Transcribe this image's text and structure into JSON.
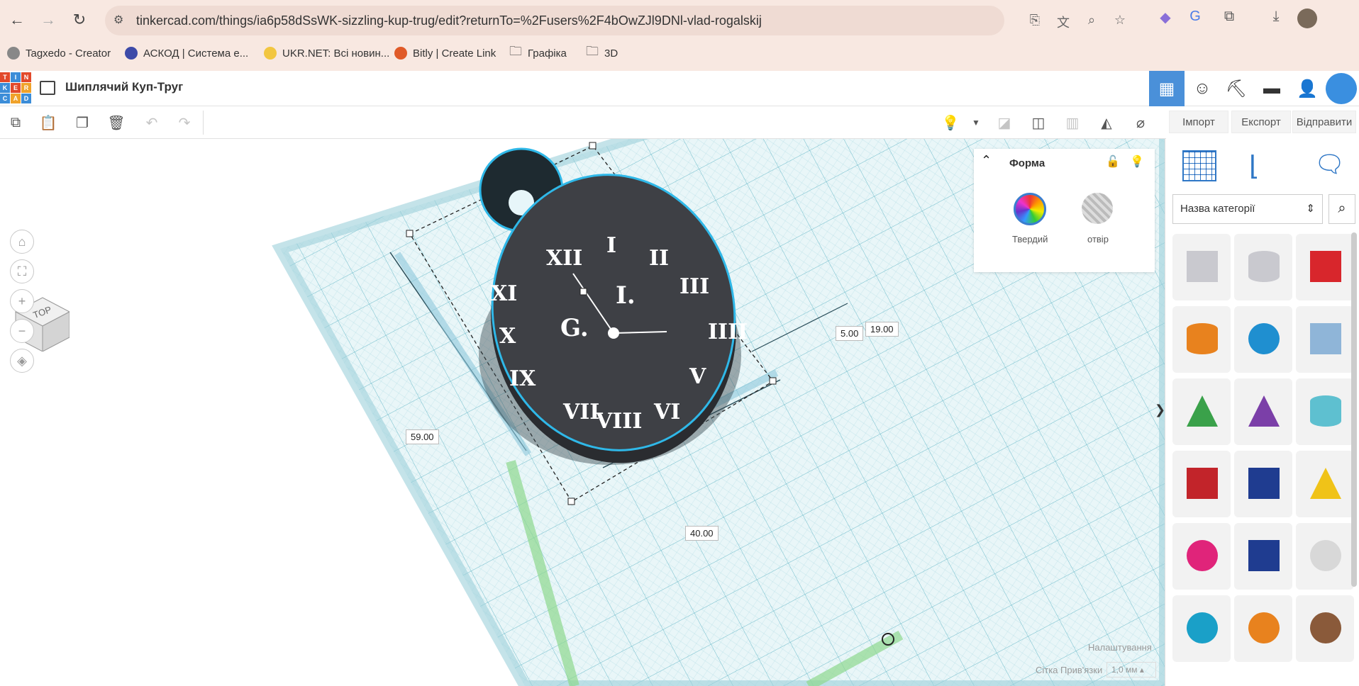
{
  "browser": {
    "url": "tinkercad.com/things/ia6p58dSsWK-sizzling-kup-trug/edit?returnTo=%2Fusers%2F4bOwZJl9DNl-vlad-rogalskij",
    "bookmarks": [
      {
        "label": "Tagxedo - Creator",
        "color": "#888888"
      },
      {
        "label": "АСКОД | Система е...",
        "color": "#3d4aa8"
      },
      {
        "label": "UKR.NET: Всі новин...",
        "color": "#f2c640"
      },
      {
        "label": "Bitly | Create Link",
        "color": "#e05a28"
      },
      {
        "label": "Графіка",
        "color": "folder"
      },
      {
        "label": "3D",
        "color": "folder"
      }
    ]
  },
  "app": {
    "logo_letters": [
      "T",
      "I",
      "N",
      "K",
      "E",
      "R",
      "C",
      "A",
      "D"
    ],
    "title": "Шиплячий Куп-Труг",
    "import_label": "Імпорт",
    "export_label": "Експорт",
    "send_label": "Відправити"
  },
  "viewcube": {
    "label": "TOP"
  },
  "shape_panel": {
    "title": "Форма",
    "solid_label": "Твердий",
    "hole_label": "отвір"
  },
  "dimensions": {
    "height": "59.00",
    "width": "40.00",
    "depth": "19.00",
    "elevation": "5.00"
  },
  "clock": {
    "numerals": [
      "I",
      "II",
      "III",
      "IIII",
      "V",
      "VI",
      "VII",
      "VIII",
      "IX",
      "X",
      "XI",
      "XII"
    ],
    "initial_left": "G.",
    "initial_right": "I."
  },
  "library": {
    "category_placeholder": "Назва категорії"
  },
  "footer": {
    "settings_label": "Налаштування",
    "snap_label": "Сітка Прив'язки",
    "snap_value": "1,0 мм"
  },
  "colors": {
    "accent": "#4a90d9",
    "grid": "#bfe3ea",
    "clock_body": "#3e4045"
  }
}
